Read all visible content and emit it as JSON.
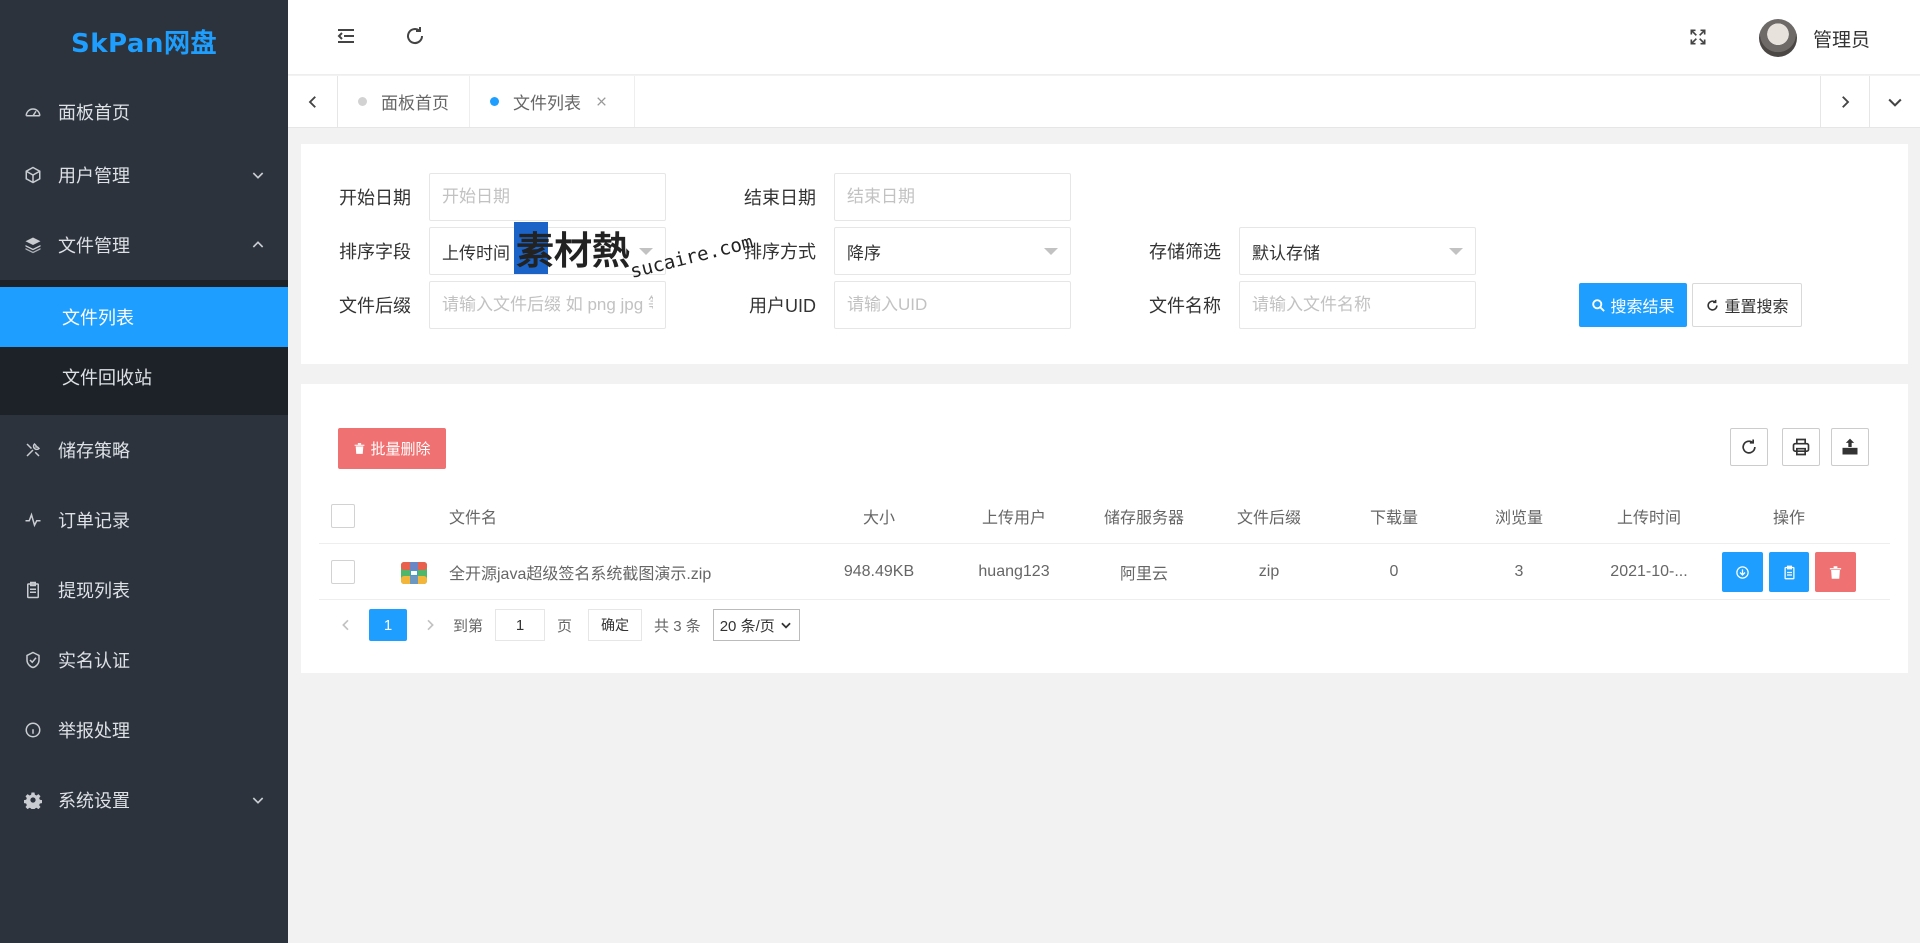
{
  "app": {
    "logo": "SkPan网盘"
  },
  "sidebar": {
    "items": [
      {
        "label": "面板首页",
        "icon": "dashboard-icon"
      },
      {
        "label": "用户管理",
        "icon": "cube-icon"
      },
      {
        "label": "文件管理",
        "icon": "layers-icon"
      },
      {
        "label": "储存策略",
        "icon": "tools-icon"
      },
      {
        "label": "订单记录",
        "icon": "pulse-icon"
      },
      {
        "label": "提现列表",
        "icon": "clipboard-icon"
      },
      {
        "label": "实名认证",
        "icon": "shield-check-icon"
      },
      {
        "label": "举报处理",
        "icon": "info-circle-icon"
      },
      {
        "label": "系统设置",
        "icon": "gear-icon"
      }
    ],
    "file_sub": [
      {
        "label": "文件列表",
        "active": true
      },
      {
        "label": "文件回收站",
        "active": false
      }
    ]
  },
  "header": {
    "user_name": "管理员"
  },
  "tabs": [
    {
      "label": "面板首页",
      "active": false
    },
    {
      "label": "文件列表",
      "active": true
    }
  ],
  "filters": {
    "start_date": {
      "label": "开始日期",
      "placeholder": "开始日期"
    },
    "end_date": {
      "label": "结束日期",
      "placeholder": "结束日期"
    },
    "sort_field": {
      "label": "排序字段",
      "value": "上传时间"
    },
    "sort_order": {
      "label": "排序方式",
      "value": "降序"
    },
    "storage": {
      "label": "存储筛选",
      "value": "默认存储"
    },
    "suffix": {
      "label": "文件后缀",
      "placeholder": "请输入文件后缀 如 png jpg 等"
    },
    "uid": {
      "label": "用户UID",
      "placeholder": "请输入UID"
    },
    "filename": {
      "label": "文件名称",
      "placeholder": "请输入文件名称"
    },
    "search_label": "搜索结果",
    "reset_label": "重置搜索"
  },
  "watermark": {
    "cn": "素材熱",
    "en": "sucaire.com"
  },
  "table": {
    "batch_delete_label": "批量删除",
    "columns": [
      "文件名",
      "大小",
      "上传用户",
      "储存服务器",
      "文件后缀",
      "下载量",
      "浏览量",
      "上传时间",
      "操作"
    ],
    "rows": [
      {
        "name": "全开源java超级签名系统截图演示.zip",
        "size": "948.49KB",
        "user": "huang123",
        "server": "阿里云",
        "suffix": "zip",
        "downloads": "0",
        "views": "3",
        "time": "2021-10-..."
      }
    ]
  },
  "pagination": {
    "current": "1",
    "goto_prefix": "到第",
    "goto_value": "1",
    "goto_suffix": "页",
    "ok_label": "确定",
    "total": "共 3 条",
    "page_size": "20 条/页"
  },
  "colors": {
    "primary": "#1e9fff",
    "danger": "#f07171",
    "sidebar_bg": "#2c333c",
    "logo": "#1e9fff"
  }
}
